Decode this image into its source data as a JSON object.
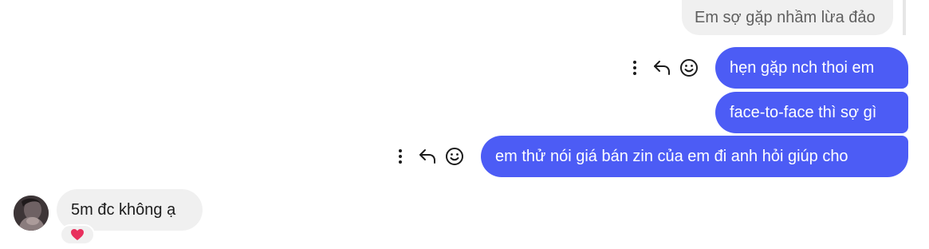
{
  "conversation": {
    "reply_preview": "Em sợ gặp nhầm lừa đảo",
    "messages": [
      {
        "text": "hẹn gặp nch thoi em"
      },
      {
        "text": "face-to-face thì sợ gì"
      },
      {
        "text": "em thử nói giá bán zin của em đi anh hỏi giúp cho"
      }
    ],
    "incoming": {
      "text": "5m đc không ạ",
      "reaction": "heart-icon"
    }
  },
  "icons": [
    "more-vertical-icon",
    "reply-icon",
    "smile-icon",
    "heart-icon"
  ],
  "colors": {
    "outgoing_bubble": "#4c5cf5",
    "incoming_bubble": "#f0f0f0",
    "reaction_heart": "#e8305d",
    "icon": "#1c1c1c"
  }
}
